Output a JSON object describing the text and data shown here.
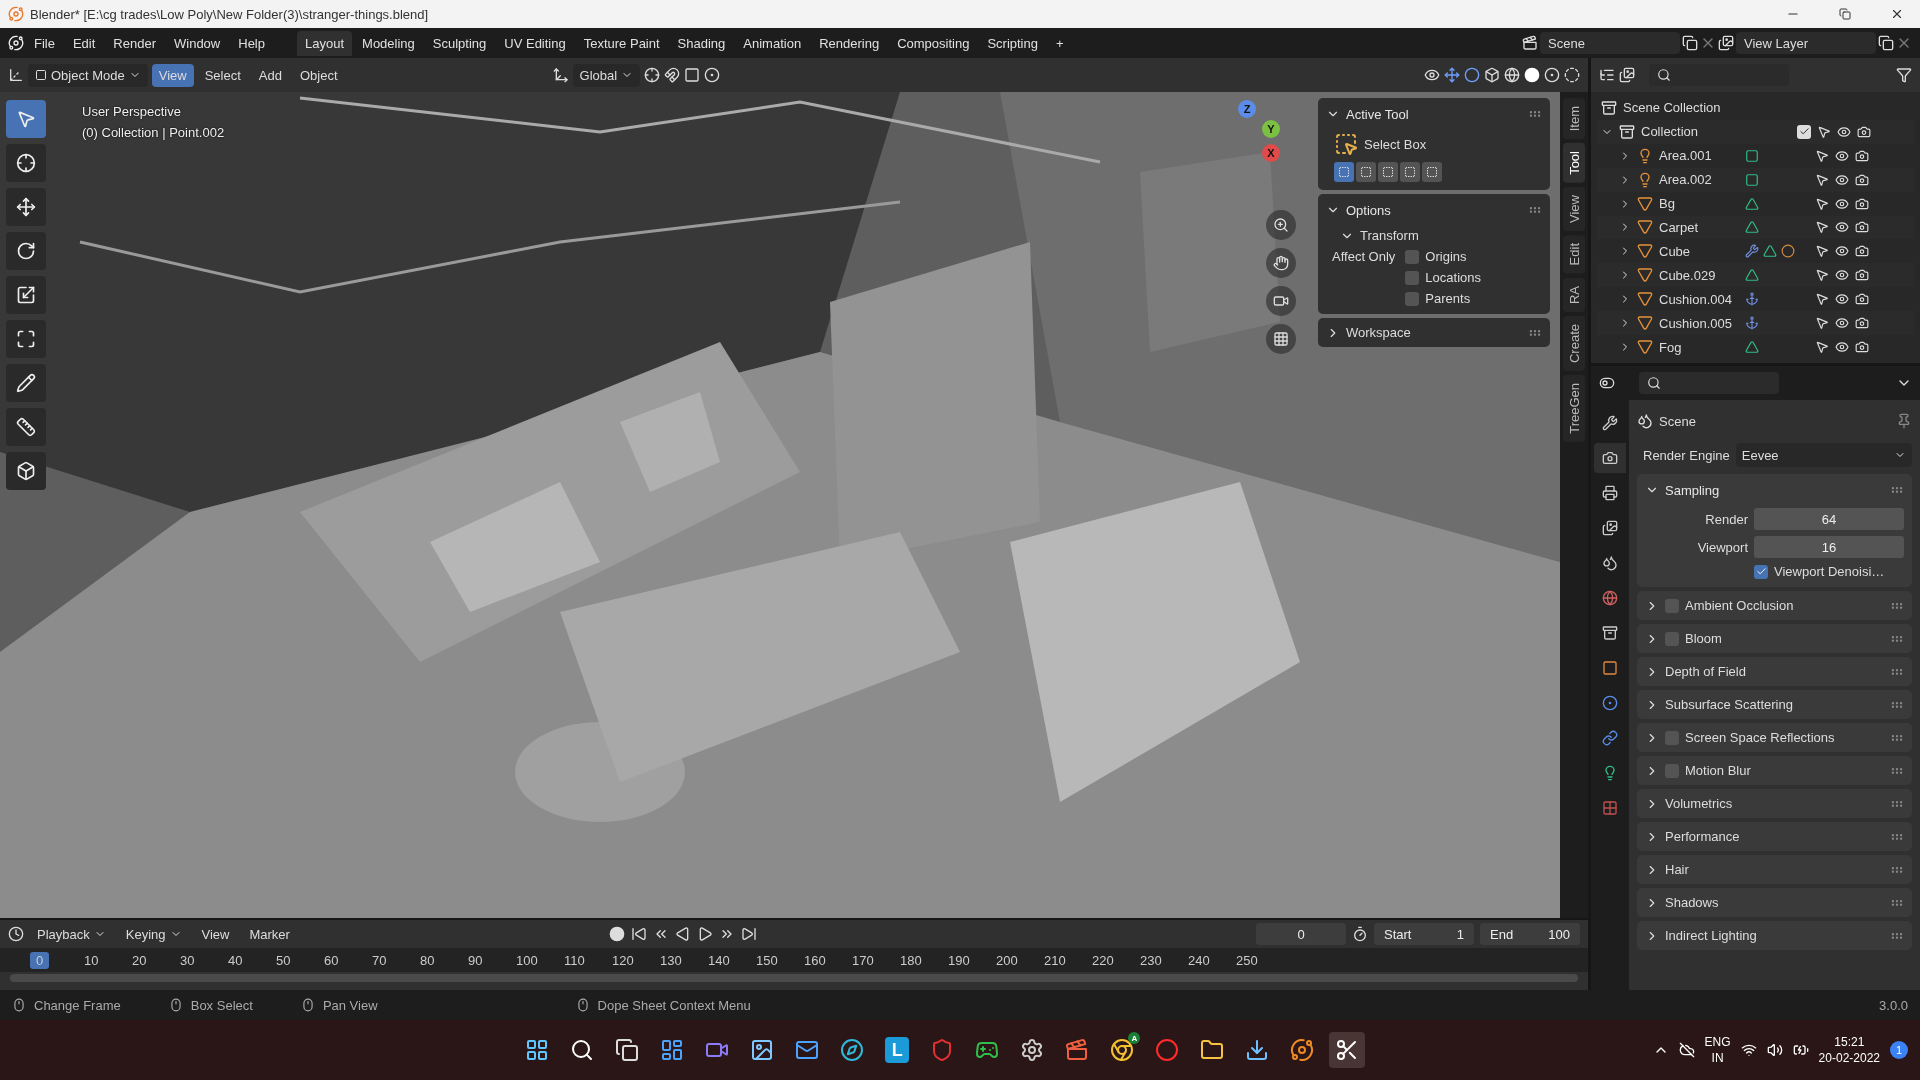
{
  "title_bar": {
    "title": "Blender* [E:\\cg trades\\Low Poly\\New Folder(3)\\stranger-things.blend]"
  },
  "menu": [
    "File",
    "Edit",
    "Render",
    "Window",
    "Help"
  ],
  "workspaces": [
    {
      "label": "Layout",
      "selected": true
    },
    {
      "label": "Modeling",
      "selected": false
    },
    {
      "label": "Sculpting",
      "selected": false
    },
    {
      "label": "UV Editing",
      "selected": false
    },
    {
      "label": "Texture Paint",
      "selected": false
    },
    {
      "label": "Shading",
      "selected": false
    },
    {
      "label": "Animation",
      "selected": false
    },
    {
      "label": "Rendering",
      "selected": false
    },
    {
      "label": "Compositing",
      "selected": false
    },
    {
      "label": "Scripting",
      "selected": false
    },
    {
      "label": "+",
      "selected": false
    }
  ],
  "scene": "Scene",
  "view_layer": "View Layer",
  "viewport_header": {
    "mode": "Object Mode",
    "menus": [
      {
        "label": "View",
        "selected": true
      },
      {
        "label": "Select",
        "selected": false
      },
      {
        "label": "Add",
        "selected": false
      },
      {
        "label": "Object",
        "selected": false
      }
    ],
    "orientation": "Global"
  },
  "toolbar": [
    {
      "kind": "select",
      "selected": true
    },
    {
      "kind": "cursor",
      "selected": false
    },
    {
      "kind": "move",
      "selected": false
    },
    {
      "kind": "rotate",
      "selected": false
    },
    {
      "kind": "scale",
      "selected": false
    },
    {
      "kind": "transform",
      "selected": false
    },
    {
      "kind": "annotate",
      "selected": false
    },
    {
      "kind": "measure",
      "selected": false
    },
    {
      "kind": "add-cube",
      "selected": false
    }
  ],
  "viewport": {
    "kind": "picture",
    "overlay": [
      "User Perspective",
      "(0) Collection | Point.002"
    ],
    "axes": [
      "Z",
      "Y",
      "X"
    ]
  },
  "sidebar": {
    "active_tool": {
      "title": "Active Tool",
      "tool": "Select Box",
      "modes": [
        {
          "selected": true
        },
        {
          "selected": false
        },
        {
          "selected": false
        },
        {
          "selected": false
        },
        {
          "selected": false
        }
      ]
    },
    "options": {
      "title": "Options",
      "transform": "Transform",
      "affect_only": "Affect Only",
      "checks": [
        {
          "label": "Origins",
          "checked": false
        },
        {
          "label": "Locations",
          "checked": false
        },
        {
          "label": "Parents",
          "checked": false
        }
      ]
    },
    "workspace": "Workspace",
    "tabs": [
      {
        "label": "Item",
        "selected": false
      },
      {
        "label": "Tool",
        "selected": true
      },
      {
        "label": "View",
        "selected": false
      },
      {
        "label": "Edit",
        "selected": false
      },
      {
        "label": "RA",
        "selected": false
      },
      {
        "label": "Create",
        "selected": false
      },
      {
        "label": "TreeGen",
        "selected": false
      }
    ]
  },
  "outliner": {
    "root": "Scene Collection",
    "collection": {
      "name": "Collection",
      "checked": true,
      "expanded": true,
      "children": [
        {
          "name": "Area.001",
          "kind": "light"
        },
        {
          "name": "Area.002",
          "kind": "light"
        },
        {
          "name": "Bg",
          "kind": "mesh"
        },
        {
          "name": "Carpet",
          "kind": "mesh"
        },
        {
          "name": "Cube",
          "kind": "modified"
        },
        {
          "name": "Cube.029",
          "kind": "mesh"
        },
        {
          "name": "Cushion.004",
          "kind": "hooked"
        },
        {
          "name": "Cushion.005",
          "kind": "hooked"
        },
        {
          "name": "Fog",
          "kind": "mesh"
        }
      ]
    }
  },
  "properties": {
    "tabs": [
      {
        "kind": "tool",
        "selected": false
      },
      {
        "kind": "render",
        "selected": true
      },
      {
        "kind": "output",
        "selected": false
      },
      {
        "kind": "view-layer",
        "selected": false
      },
      {
        "kind": "scene",
        "selected": false
      },
      {
        "kind": "world",
        "selected": false
      },
      {
        "kind": "collection",
        "selected": false
      },
      {
        "kind": "object",
        "selected": false
      },
      {
        "kind": "physics",
        "selected": false
      },
      {
        "kind": "constraints",
        "selected": false
      },
      {
        "kind": "data",
        "selected": false
      },
      {
        "kind": "texture",
        "selected": false
      }
    ],
    "context": "Scene",
    "engine_label": "Render Engine",
    "engine": "Eevee",
    "sampling": {
      "title": "Sampling",
      "expanded": true,
      "fields": [
        {
          "label": "Render",
          "value": "64"
        },
        {
          "label": "Viewport",
          "value": "16"
        }
      ],
      "denoise": {
        "label": "Viewport Denoisi…",
        "checked": true
      }
    },
    "panels": [
      {
        "label": "Ambient Occlusion",
        "kind": "toggle",
        "checked": false
      },
      {
        "label": "Bloom",
        "kind": "toggle",
        "checked": false
      },
      {
        "label": "Depth of Field",
        "kind": "plain"
      },
      {
        "label": "Subsurface Scattering",
        "kind": "plain"
      },
      {
        "label": "Screen Space Reflections",
        "kind": "toggle",
        "checked": false
      },
      {
        "label": "Motion Blur",
        "kind": "toggle",
        "checked": false
      },
      {
        "label": "Volumetrics",
        "kind": "plain"
      },
      {
        "label": "Performance",
        "kind": "plain"
      },
      {
        "label": "Hair",
        "kind": "plain"
      },
      {
        "label": "Shadows",
        "kind": "plain"
      },
      {
        "label": "Indirect Lighting",
        "kind": "plain"
      }
    ]
  },
  "timeline": {
    "menus": [
      "Playback",
      "Keying",
      "View",
      "Marker"
    ],
    "frame": "0",
    "start_label": "Start",
    "start": "1",
    "end_label": "End",
    "end": "100",
    "ticks": [
      {
        "label": "0",
        "selected": true
      },
      {
        "label": "10",
        "selected": false
      },
      {
        "label": "20",
        "selected": false
      },
      {
        "label": "30",
        "selected": false
      },
      {
        "label": "40",
        "selected": false
      },
      {
        "label": "50",
        "selected": false
      },
      {
        "label": "60",
        "selected": false
      },
      {
        "label": "70",
        "selected": false
      },
      {
        "label": "80",
        "selected": false
      },
      {
        "label": "90",
        "selected": false
      },
      {
        "label": "100",
        "selected": false
      },
      {
        "label": "110",
        "selected": false
      },
      {
        "label": "120",
        "selected": false
      },
      {
        "label": "130",
        "selected": false
      },
      {
        "label": "140",
        "selected": false
      },
      {
        "label": "150",
        "selected": false
      },
      {
        "label": "160",
        "selected": false
      },
      {
        "label": "170",
        "selected": false
      },
      {
        "label": "180",
        "selected": false
      },
      {
        "label": "190",
        "selected": false
      },
      {
        "label": "200",
        "selected": false
      },
      {
        "label": "210",
        "selected": false
      },
      {
        "label": "220",
        "selected": false
      },
      {
        "label": "230",
        "selected": false
      },
      {
        "label": "240",
        "selected": false
      },
      {
        "label": "250",
        "selected": false
      }
    ]
  },
  "status_bar": {
    "hints": [
      "Change Frame",
      "Box Select",
      "Pan View",
      "Dope Sheet Context Menu"
    ],
    "version": "3.0.0"
  },
  "taskbar": {
    "apps": [
      {
        "kind": "start"
      },
      {
        "kind": "search"
      },
      {
        "kind": "task-view"
      },
      {
        "kind": "widgets"
      },
      {
        "kind": "chat"
      },
      {
        "kind": "photos"
      },
      {
        "kind": "mail"
      },
      {
        "kind": "browser"
      },
      {
        "kind": "letter",
        "text": "L"
      },
      {
        "kind": "shield"
      },
      {
        "kind": "gamepad"
      },
      {
        "kind": "settings"
      },
      {
        "kind": "editor"
      },
      {
        "kind": "globe",
        "badge": "A"
      },
      {
        "kind": "ring"
      },
      {
        "kind": "folder"
      },
      {
        "kind": "installer"
      },
      {
        "kind": "orbit"
      },
      {
        "kind": "scissors",
        "selected": true
      }
    ],
    "lang": "ENG",
    "region": "IN",
    "time": "15:21",
    "date": "20-02-2022",
    "notifications": "1"
  }
}
